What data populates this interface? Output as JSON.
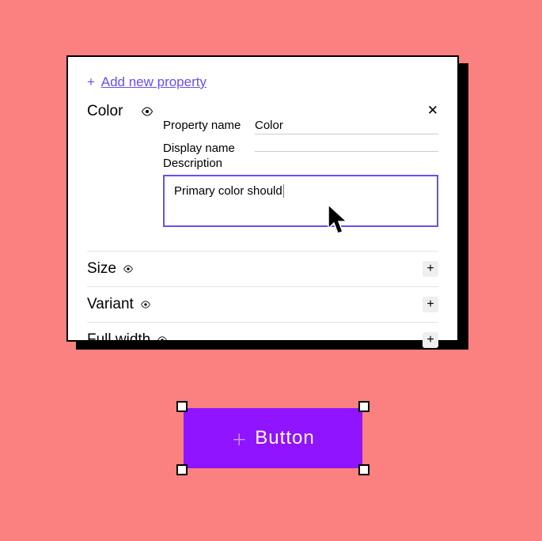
{
  "panel": {
    "add_new": "Add new property",
    "expanded": {
      "name": "Color",
      "fields": {
        "prop_name_label": "Property name",
        "prop_name_value": "Color",
        "display_name_label": "Display name",
        "display_name_value": "",
        "description_label": "Description",
        "description_value": "Primary color should "
      }
    },
    "properties": [
      {
        "label": "Size"
      },
      {
        "label": "Variant"
      },
      {
        "label": "Full width"
      }
    ]
  },
  "component": {
    "label": "Button"
  }
}
